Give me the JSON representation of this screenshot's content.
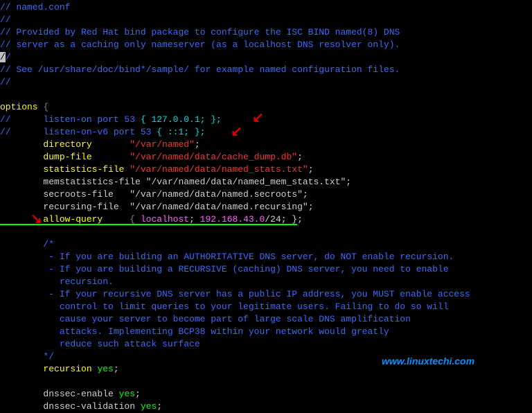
{
  "header_comments": [
    "// named.conf",
    "//",
    "// Provided by Red Hat bind package to configure the ISC BIND named(8) DNS",
    "// server as a caching only nameserver (as a localhost DNS resolver only).",
    "//",
    "// See /usr/share/doc/bind*/sample/ for example named configuration files.",
    "//"
  ],
  "cursor_slash": "/",
  "options_open": "options ",
  "brace_open": "{",
  "listen_v4_prefix": "//      listen-on port 53 ",
  "listen_v4_body": "{ 127.0.0.1; };",
  "listen_v6_prefix": "//      listen-on-v6 port 53 ",
  "listen_v6_body": "{ ::1; };",
  "directory_key": "        directory       ",
  "directory_val": "\"/var/named\"",
  "dumpfile_key": "        dump-file       ",
  "dumpfile_val": "\"/var/named/data/cache_dump.db\"",
  "statsfile_key": "        statistics-file ",
  "statsfile_val": "\"/var/named/data/named_stats.txt\"",
  "memstats_key": "        memstatistics-file ",
  "memstats_val": "\"/var/named/data/named_mem_stats.txt\"",
  "secroots_key": "        secroots-file   ",
  "secroots_val": "\"/var/named/data/named.secroots\"",
  "recursing_key": "        recursing-file  ",
  "recursing_val": "\"/var/named/data/named.recursing\"",
  "allowquery_key": "        allow-query     ",
  "allowquery_b1": "{ ",
  "allowquery_localhost": "localhost",
  "allowquery_sep": "; ",
  "allowquery_net": "192.168.43.0",
  "allowquery_suffix": "/24; }",
  "semicolon": ";",
  "c_open": "        /*",
  "c1": "         - If you are building an AUTHORITATIVE DNS server, do NOT enable recursion.",
  "c2": "         - If you are building a RECURSIVE (caching) DNS server, you need to enable",
  "c2b": "           recursion.",
  "c3": "         - If your recursive DNS server has a public IP address, you MUST enable access",
  "c3b": "           control to limit queries to your legitimate users. Failing to do so will",
  "c3c": "           cause your server to become part of large scale DNS amplification",
  "c3d": "           attacks. Implementing BCP38 within your network would greatly",
  "c3e": "           reduce such attack surface",
  "c_close": "        */",
  "recursion_key": "        recursion ",
  "yes_val": "yes",
  "dnssec_enable_key": "        dnssec-enable ",
  "dnssec_valid_key": "        dnssec-validation ",
  "watermark": "www.linuxtechi.com"
}
